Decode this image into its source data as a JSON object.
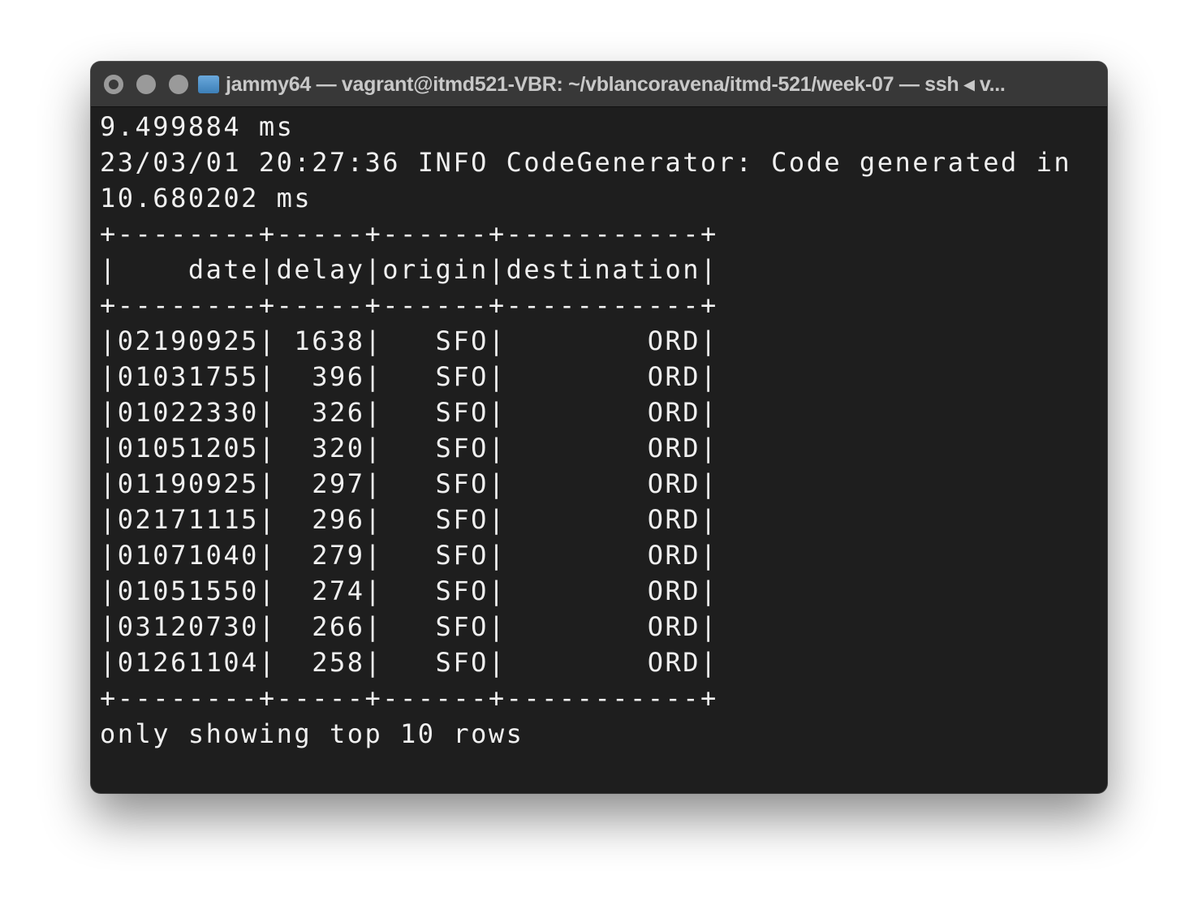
{
  "window": {
    "title": "jammy64 — vagrant@itmd521-VBR: ~/vblancoravena/itmd-521/week-07 — ssh ◂ v..."
  },
  "terminal": {
    "pre_lines": [
      "9.499884 ms",
      "23/03/01 20:27:36 INFO CodeGenerator: Code generated in",
      "10.680202 ms"
    ],
    "table": {
      "columns": [
        "date",
        "delay",
        "origin",
        "destination"
      ],
      "widths": [
        8,
        5,
        6,
        11
      ],
      "rows": [
        [
          "02190925",
          "1638",
          "SFO",
          "ORD"
        ],
        [
          "01031755",
          "396",
          "SFO",
          "ORD"
        ],
        [
          "01022330",
          "326",
          "SFO",
          "ORD"
        ],
        [
          "01051205",
          "320",
          "SFO",
          "ORD"
        ],
        [
          "01190925",
          "297",
          "SFO",
          "ORD"
        ],
        [
          "02171115",
          "296",
          "SFO",
          "ORD"
        ],
        [
          "01071040",
          "279",
          "SFO",
          "ORD"
        ],
        [
          "01051550",
          "274",
          "SFO",
          "ORD"
        ],
        [
          "03120730",
          "266",
          "SFO",
          "ORD"
        ],
        [
          "01261104",
          "258",
          "SFO",
          "ORD"
        ]
      ]
    },
    "footer": "only showing top 10 rows"
  }
}
